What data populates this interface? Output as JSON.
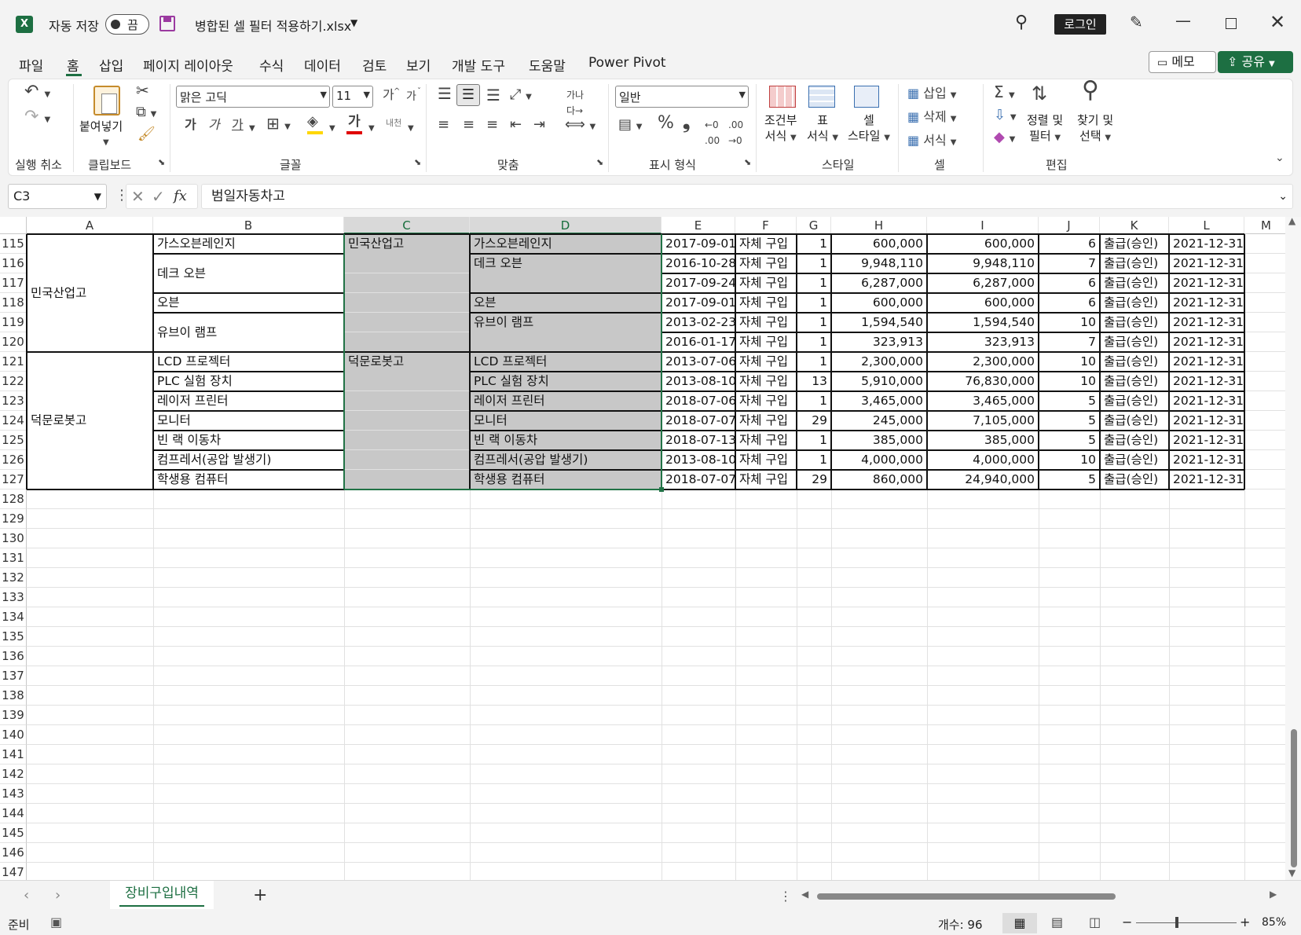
{
  "titlebar": {
    "autosave_label": "자동 저장",
    "autosave_state": "끔",
    "filename": "병합된 셀 필터 적용하기.xlsx",
    "login": "로그인"
  },
  "menu": {
    "items": [
      "파일",
      "홈",
      "삽입",
      "페이지 레이아웃",
      "수식",
      "데이터",
      "검토",
      "보기",
      "개발 도구",
      "도움말",
      "Power Pivot"
    ],
    "active": "홈",
    "memo": "메모",
    "share": "공유"
  },
  "ribbon": {
    "groups": [
      "실행 취소",
      "클립보드",
      "글꼴",
      "맞춤",
      "표시 형식",
      "스타일",
      "셀",
      "편집"
    ],
    "paste": "붙여넣기",
    "font_name": "맑은 고딕",
    "font_size": "11",
    "bold": "가",
    "italic": "가",
    "underline": "가",
    "grow": "가",
    "shrink": "가",
    "number_format": "일반",
    "cond_format": [
      "조건부",
      "서식"
    ],
    "table_format": [
      "표",
      "서식"
    ],
    "cell_style": [
      "셀",
      "스타일"
    ],
    "insert": "삽입",
    "delete": "삭제",
    "format": "서식",
    "sort_filter": [
      "정렬 및",
      "필터"
    ],
    "find_select": [
      "찾기 및",
      "선택"
    ]
  },
  "formula_bar": {
    "name_box": "C3",
    "fx": "fx",
    "content": "범일자동차고"
  },
  "grid": {
    "columns": [
      "A",
      "B",
      "C",
      "D",
      "E",
      "F",
      "G",
      "H",
      "I",
      "J",
      "K",
      "L",
      "M"
    ],
    "selected_columns": [
      "C",
      "D"
    ],
    "row_numbers": [
      "115",
      "116",
      "117",
      "118",
      "119",
      "120",
      "121",
      "122",
      "123",
      "124",
      "125",
      "126",
      "127",
      "128",
      "129",
      "130",
      "131",
      "132",
      "133",
      "134",
      "135",
      "136",
      "137",
      "138",
      "139",
      "140",
      "141",
      "142",
      "143",
      "144",
      "145",
      "146",
      "147"
    ],
    "merged_a": [
      "민국산업고",
      "덕문로봇고"
    ],
    "merged_b": [
      "가스오븐레인지",
      "데크 오븐",
      "오븐",
      "유브이 램프",
      "LCD 프로젝터",
      "PLC 실험 장치",
      "레이저 프린터",
      "모니터",
      "빈 랙 이동차",
      "컴프레서(공압 발생기)",
      "학생용 컴퓨터"
    ],
    "col_c": [
      "민국산업고",
      "덕문로봇고"
    ],
    "col_d": [
      "가스오븐레인지",
      "데크 오븐",
      "오븐",
      "유브이 램프",
      "LCD 프로젝터",
      "PLC 실험 장치",
      "레이저 프린터",
      "모니터",
      "빈 랙 이동차",
      "컴프레서(공압 발생기)",
      "학생용 컴퓨터"
    ],
    "rows": [
      [
        "2017-09-01",
        "자체 구입",
        "1",
        "600,000",
        "600,000",
        "6",
        "출급(승인)",
        "2021-12-31"
      ],
      [
        "2016-10-28",
        "자체 구입",
        "1",
        "9,948,110",
        "9,948,110",
        "7",
        "출급(승인)",
        "2021-12-31"
      ],
      [
        "2017-09-24",
        "자체 구입",
        "1",
        "6,287,000",
        "6,287,000",
        "6",
        "출급(승인)",
        "2021-12-31"
      ],
      [
        "2017-09-01",
        "자체 구입",
        "1",
        "600,000",
        "600,000",
        "6",
        "출급(승인)",
        "2021-12-31"
      ],
      [
        "2013-02-23",
        "자체 구입",
        "1",
        "1,594,540",
        "1,594,540",
        "10",
        "출급(승인)",
        "2021-12-31"
      ],
      [
        "2016-01-17",
        "자체 구입",
        "1",
        "323,913",
        "323,913",
        "7",
        "출급(승인)",
        "2021-12-31"
      ],
      [
        "2013-07-06",
        "자체 구입",
        "1",
        "2,300,000",
        "2,300,000",
        "10",
        "출급(승인)",
        "2021-12-31"
      ],
      [
        "2013-08-10",
        "자체 구입",
        "13",
        "5,910,000",
        "76,830,000",
        "10",
        "출급(승인)",
        "2021-12-31"
      ],
      [
        "2018-07-06",
        "자체 구입",
        "1",
        "3,465,000",
        "3,465,000",
        "5",
        "출급(승인)",
        "2021-12-31"
      ],
      [
        "2018-07-07",
        "자체 구입",
        "29",
        "245,000",
        "7,105,000",
        "5",
        "출급(승인)",
        "2021-12-31"
      ],
      [
        "2018-07-13",
        "자체 구입",
        "1",
        "385,000",
        "385,000",
        "5",
        "출급(승인)",
        "2021-12-31"
      ],
      [
        "2013-08-10",
        "자체 구입",
        "1",
        "4,000,000",
        "4,000,000",
        "10",
        "출급(승인)",
        "2021-12-31"
      ],
      [
        "2018-07-07",
        "자체 구입",
        "29",
        "860,000",
        "24,940,000",
        "5",
        "출급(승인)",
        "2021-12-31"
      ]
    ]
  },
  "sheets": {
    "tabs": [
      "장비구입내역"
    ],
    "add": "+"
  },
  "status": {
    "ready": "준비",
    "count": "개수: 96",
    "zoom": "85%"
  }
}
